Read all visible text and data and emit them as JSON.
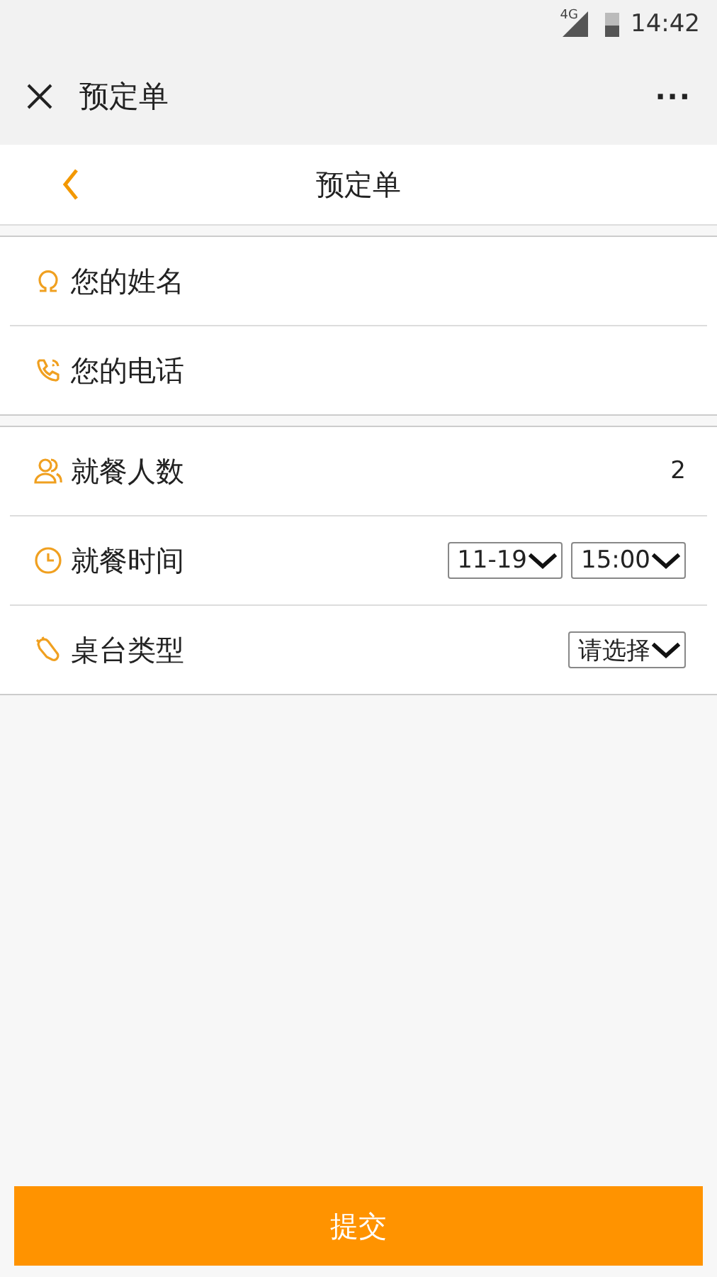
{
  "status_bar": {
    "network": "4G",
    "time": "14:42"
  },
  "title_bar": {
    "title": "预定单",
    "more": "···"
  },
  "header": {
    "title": "预定单"
  },
  "groups": [
    {
      "rows": [
        {
          "kind": "input",
          "placeholder": "您的姓名"
        },
        {
          "kind": "input",
          "placeholder": "您的电话"
        }
      ]
    },
    {
      "rows": [
        {
          "kind": "value",
          "label": "就餐人数",
          "value": "2"
        },
        {
          "kind": "selects",
          "label": "就餐时间",
          "selects": [
            "11-19",
            "15:00"
          ]
        },
        {
          "kind": "selects",
          "label": "桌台类型",
          "selects": [
            "请选择"
          ]
        }
      ]
    }
  ],
  "submit": "提交"
}
